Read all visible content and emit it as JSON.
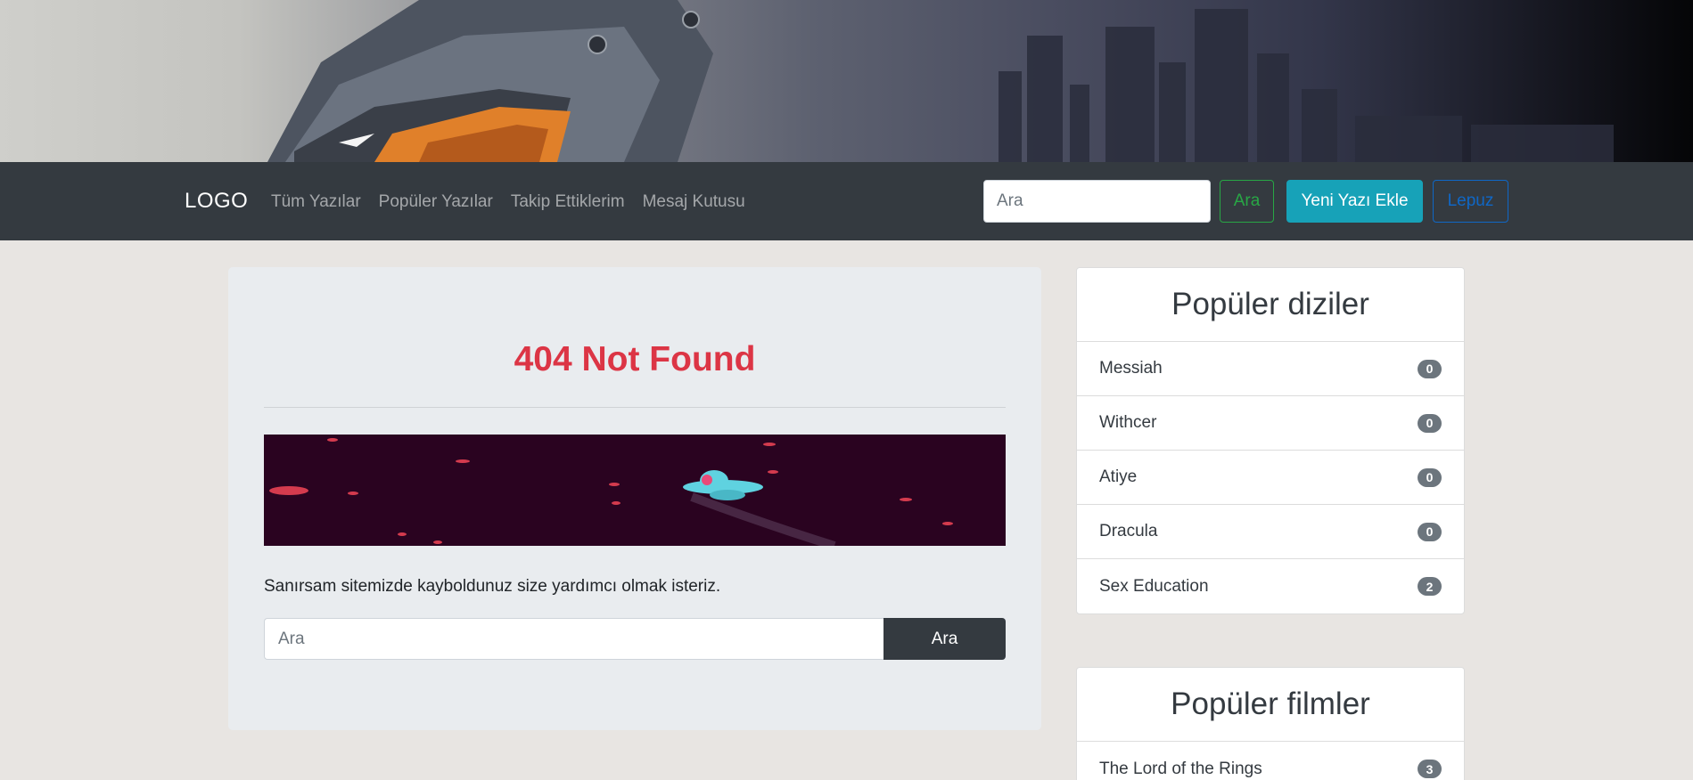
{
  "banner": {
    "description_icon": "helmet-cityscape-banner"
  },
  "navbar": {
    "logo": "LOGO",
    "links": [
      "Tüm Yazılar",
      "Popüler Yazılar",
      "Takip Ettiklerim",
      "Mesaj Kutusu"
    ],
    "search_placeholder": "Ara",
    "search_button": "Ara",
    "new_post_button": "Yeni Yazı Ekle",
    "user_button": "Lepuz"
  },
  "main": {
    "title": "404 Not Found",
    "message": "Sanırsam sitemizde kayboldunuz size yardımcı olmak isteriz.",
    "search_placeholder": "Ara",
    "search_button": "Ara"
  },
  "popular_series": {
    "title": "Popüler diziler",
    "items": [
      {
        "label": "Messiah",
        "count": "0"
      },
      {
        "label": "Withcer",
        "count": "0"
      },
      {
        "label": "Atiye",
        "count": "0"
      },
      {
        "label": "Dracula",
        "count": "0"
      },
      {
        "label": "Sex Education",
        "count": "2"
      }
    ]
  },
  "popular_movies": {
    "title": "Popüler filmler",
    "items": [
      {
        "label": "The Lord of the Rings",
        "count": "3"
      }
    ]
  },
  "colors": {
    "navbar": "#343a40",
    "danger": "#dc3545",
    "success": "#28a745",
    "info": "#17a2b8",
    "primary": "#007bff",
    "badge": "#6c757d"
  }
}
